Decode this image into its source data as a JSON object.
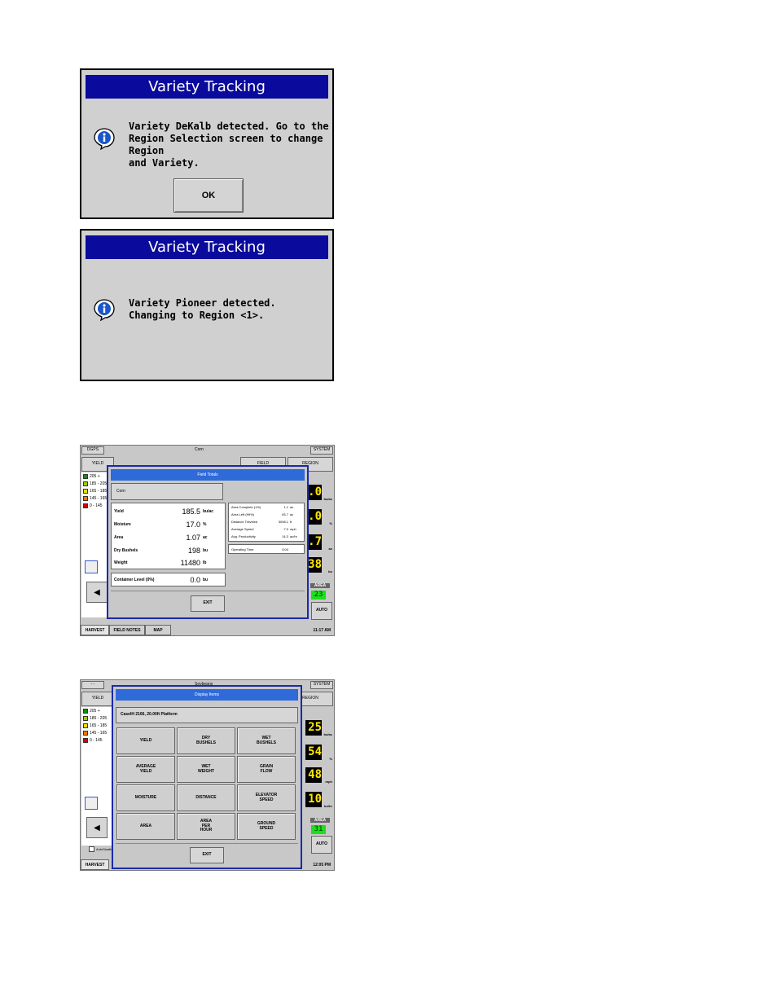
{
  "dialog1": {
    "title": "Variety Tracking",
    "message": "Variety DeKalb detected.  Go to the\nRegion Selection screen to change Region\nand Variety.",
    "ok_label": "OK"
  },
  "dialog2": {
    "title": "Variety Tracking",
    "message": "Variety Pioneer detected.\nChanging to Region <1>."
  },
  "screen1": {
    "top_left": "DGPS",
    "top_center": "Corn",
    "system_label": "SYSTEM",
    "yield_btn": "YIELD",
    "field_btn": "FIELD",
    "region_btn": "REGION",
    "legend": [
      {
        "label": "205 +",
        "color": "#0f8f0f"
      },
      {
        "label": "185 - 205",
        "color": "#9acd00"
      },
      {
        "label": "165 - 185",
        "color": "#f0e000"
      },
      {
        "label": "145 - 165",
        "color": "#f07800"
      },
      {
        "label": "0 - 145",
        "color": "#d00000"
      }
    ],
    "modal": {
      "title": "Field Totals",
      "crop_button": "Corn",
      "rows": [
        {
          "label": "Yield",
          "value": "185.5",
          "unit": "bu/ac"
        },
        {
          "label": "Moisture",
          "value": "17.0",
          "unit": "%"
        },
        {
          "label": "Area",
          "value": "1.07",
          "unit": "ac"
        },
        {
          "label": "Dry Bushels",
          "value": "198",
          "unit": "bu"
        },
        {
          "label": "Weight",
          "value": "11480",
          "unit": "lb"
        }
      ],
      "container_label": "Container Level (0%)",
      "container_value": "0.0",
      "container_unit": "bu",
      "stats": [
        {
          "label": "Area Complete (1%)",
          "value": "1.1",
          "unit": "ac"
        },
        {
          "label": "Area Left (99%)",
          "value": "63.7",
          "unit": "ac"
        },
        {
          "label": "Distance Traveled",
          "value": "3098.1",
          "unit": "ft"
        },
        {
          "label": "Average Speed",
          "value": "7.0",
          "unit": "mph"
        },
        {
          "label": "Avg. Productivity",
          "value": "14.3",
          "unit": "ac/hr"
        }
      ],
      "operating_label": "Operating Time",
      "operating_value": "0:04",
      "exit_label": "EXIT"
    },
    "lcd": [
      {
        "value": ".0",
        "unit": "bu/ac"
      },
      {
        "value": ".0",
        "unit": "%"
      },
      {
        "value": ".7",
        "unit": "ac"
      },
      {
        "value": "38",
        "unit": "bu"
      }
    ],
    "area_label": "AREA",
    "area_value": "23",
    "auto_label": "AUTO",
    "tabs": [
      "HARVEST",
      "FIELD NOTES",
      "MAP"
    ],
    "time": "11:17 AM"
  },
  "screen2": {
    "top_left": "- -",
    "top_center": "Soybeans",
    "system_label": "SYSTEM",
    "yield_btn": "YIELD",
    "region_btn": "REGION",
    "legend": [
      {
        "label": "205 +",
        "color": "#0f8f0f"
      },
      {
        "label": "185 - 205",
        "color": "#9acd00"
      },
      {
        "label": "165 - 185",
        "color": "#f0e000"
      },
      {
        "label": "145 - 165",
        "color": "#f07800"
      },
      {
        "label": "0 - 145",
        "color": "#d00000"
      }
    ],
    "modal": {
      "title": "Display Items",
      "machine": "CaseIH 2166, 20.00ft Platform",
      "buttons": [
        "YIELD",
        "DRY\nBUSHELS",
        "WET\nBUSHELS",
        "AVERAGE\nYIELD",
        "WET\nWEIGHT",
        "GRAIN\nFLOW",
        "MOISTURE",
        "DISTANCE",
        "ELEVATOR\nSPEED",
        "AREA",
        "AREA\nPER\nHOUR",
        "GROUND\nSPEED"
      ],
      "exit_label": "EXIT"
    },
    "lcd": [
      {
        "value": "25",
        "unit": "bu/ac"
      },
      {
        "value": "54",
        "unit": "%"
      },
      {
        "value": "48",
        "unit": "mph"
      },
      {
        "value": "10",
        "unit": "bu/hr"
      }
    ],
    "area_label": "AREA",
    "area_value": "31",
    "auto_label": "AUTO",
    "autoswath_label": "AutoSwath",
    "tabs": [
      "HARVEST"
    ],
    "time": "12:05 PM"
  }
}
